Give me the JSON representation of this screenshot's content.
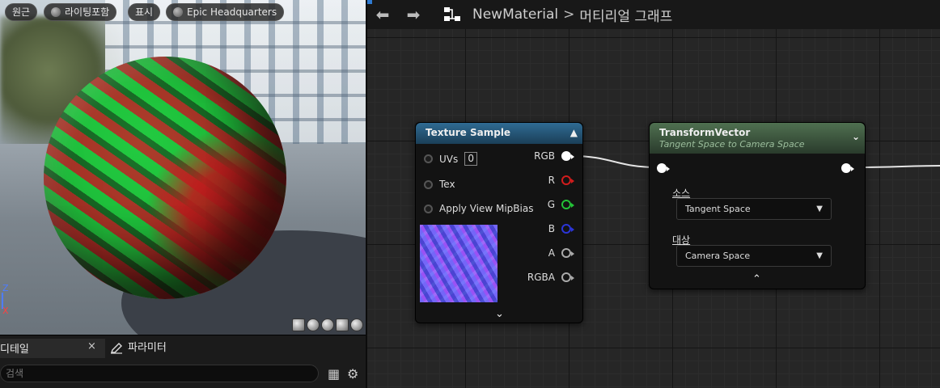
{
  "viewport": {
    "pills": [
      "원근",
      "라이팅포함",
      "표시",
      "Epic Headquarters"
    ],
    "axis": {
      "z": "Z",
      "x": "X"
    }
  },
  "details": {
    "tab_details": "디테일",
    "tab_close": "×",
    "tab_params": "파라미터",
    "search_placeholder": "검색"
  },
  "graph": {
    "breadcrumb": {
      "material": "NewMaterial",
      "separator": ">",
      "view": "머티리얼 그래프"
    }
  },
  "texture_sample": {
    "title": "Texture Sample",
    "inputs": [
      "UVs",
      "Tex",
      "Apply View MipBias"
    ],
    "uv_value": "0",
    "outputs": [
      "RGB",
      "R",
      "G",
      "B",
      "A",
      "RGBA"
    ]
  },
  "transform_vector": {
    "title": "TransformVector",
    "subtitle": "Tangent Space to Camera Space",
    "source_label": "소스",
    "source_value": "Tangent Space",
    "target_label": "대상",
    "target_value": "Camera Space"
  },
  "colors": {
    "accent": "#2f7bd3",
    "pin_red": "#d21c1c",
    "pin_green": "#23c337",
    "pin_blue": "#2b35d8"
  }
}
